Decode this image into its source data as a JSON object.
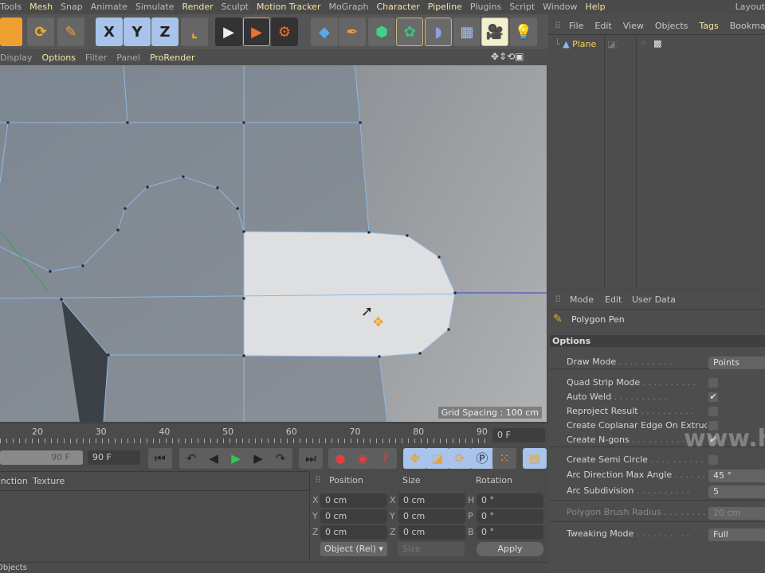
{
  "menu": [
    {
      "label": "Tools",
      "hl": false
    },
    {
      "label": "Mesh",
      "hl": true
    },
    {
      "label": "Snap",
      "hl": false
    },
    {
      "label": "Animate",
      "hl": false
    },
    {
      "label": "Simulate",
      "hl": false
    },
    {
      "label": "Render",
      "hl": true
    },
    {
      "label": "Sculpt",
      "hl": false
    },
    {
      "label": "Motion Tracker",
      "hl": true
    },
    {
      "label": "MoGraph",
      "hl": false
    },
    {
      "label": "Character",
      "hl": true
    },
    {
      "label": "Pipeline",
      "hl": true
    },
    {
      "label": "Plugins",
      "hl": false
    },
    {
      "label": "Script",
      "hl": false
    },
    {
      "label": "Window",
      "hl": false
    },
    {
      "label": "Help",
      "hl": true
    }
  ],
  "layout_label": "Layout",
  "toolbar": {
    "x": "X",
    "y": "Y",
    "z": "Z"
  },
  "viewport_menu": [
    {
      "label": "Display",
      "hl": false
    },
    {
      "label": "Options",
      "hl": true
    },
    {
      "label": "Filter",
      "hl": false
    },
    {
      "label": "Panel",
      "hl": false
    },
    {
      "label": "ProRender",
      "hl": true
    }
  ],
  "viewport": {
    "grid_spacing": "Grid Spacing : 100 cm",
    "edge_color": "#8db8e6",
    "selected_poly_color": "#dedfe1"
  },
  "object_manager": {
    "menu": [
      "File",
      "Edit",
      "View",
      "Objects",
      "Tags",
      "Bookmarks"
    ],
    "object": "Plane"
  },
  "timeline": {
    "ticks": [
      "20",
      "30",
      "40",
      "50",
      "60",
      "70",
      "80",
      "90"
    ],
    "current_frame": "0 F",
    "end_slider": "90 F",
    "end_frame": "90 F"
  },
  "material_manager": {
    "menu": [
      "Function",
      "Texture"
    ]
  },
  "coordinates": {
    "headers": [
      "Position",
      "Size",
      "Rotation"
    ],
    "rows": [
      {
        "pl": "X",
        "pv": "0 cm",
        "sl": "X",
        "sv": "0 cm",
        "rl": "H",
        "rv": "0 °"
      },
      {
        "pl": "Y",
        "pv": "0 cm",
        "sl": "Y",
        "sv": "0 cm",
        "rl": "P",
        "rv": "0 °"
      },
      {
        "pl": "Z",
        "pv": "0 cm",
        "sl": "Z",
        "sv": "0 cm",
        "rl": "B",
        "rv": "0 °"
      }
    ],
    "mode": "Object (Rel)",
    "size_mode": "Size",
    "apply": "Apply"
  },
  "attributes": {
    "menu": [
      "Mode",
      "Edit",
      "User Data"
    ],
    "tool": "Polygon Pen",
    "section": "Options",
    "draw_mode": {
      "label": "Draw Mode",
      "value": "Points"
    },
    "quad_strip": {
      "label": "Quad Strip Mode",
      "checked": false
    },
    "auto_weld": {
      "label": "Auto Weld",
      "checked": true
    },
    "reproject": {
      "label": "Reproject Result",
      "checked": false
    },
    "coplanar": {
      "label": "Create Coplanar Edge On Extrude",
      "checked": false
    },
    "ngons": {
      "label": "Create N-gons",
      "checked": true
    },
    "semi_circle": {
      "label": "Create Semi Circle",
      "checked": false
    },
    "arc_angle": {
      "label": "Arc Direction Max Angle",
      "value": "45 °"
    },
    "arc_sub": {
      "label": "Arc Subdivision",
      "value": "5"
    },
    "brush_radius": {
      "label": "Polygon Brush Radius",
      "value": "20 cm"
    },
    "tweak": {
      "label": "Tweaking Mode",
      "value": "Full"
    }
  },
  "status": "Objects",
  "watermark": "www.honar"
}
